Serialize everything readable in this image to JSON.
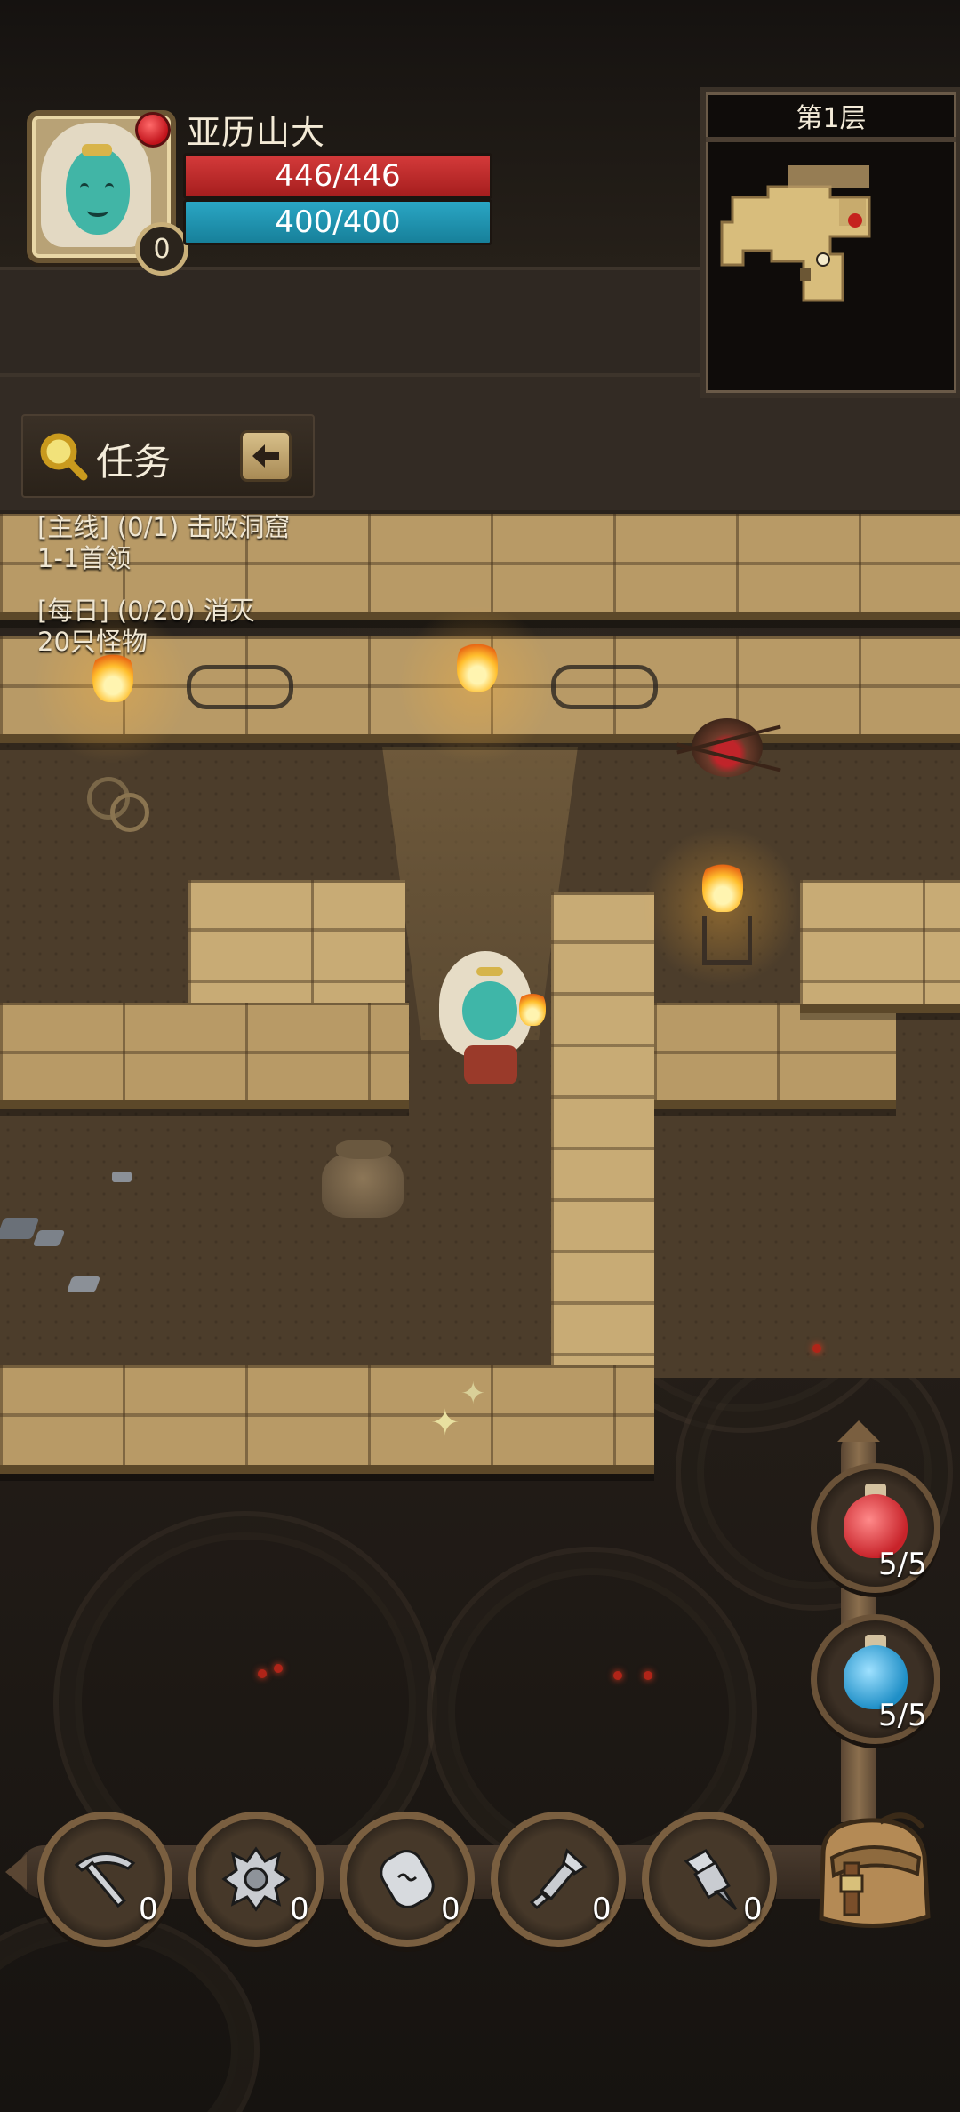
{
  "player": {
    "name": "亚历山大",
    "level": "0",
    "hp": "446/446",
    "mp": "400/400",
    "hp_fraction": 1.0,
    "mp_fraction": 1.0
  },
  "minimap": {
    "floor_label": "第1层"
  },
  "quest": {
    "title": "任务",
    "entries": [
      "[主线] (0/1) 击败洞窟\n1-1首领",
      "[每日] (0/20) 消灭\n20只怪物"
    ]
  },
  "potions": {
    "health_count": "5/5",
    "mana_count": "5/5"
  },
  "toolbar": {
    "tools": [
      {
        "name": "pickaxe-icon",
        "count": "0"
      },
      {
        "name": "spiked-shield-icon",
        "count": "0"
      },
      {
        "name": "scroll-bomb-icon",
        "count": "0"
      },
      {
        "name": "claw-tool-icon",
        "count": "0"
      },
      {
        "name": "drill-icon",
        "count": "0"
      }
    ]
  },
  "colors": {
    "hp_bar": "#c22c2c",
    "mp_bar": "#2196b3",
    "parchment": "#b89a66",
    "frame_gold": "#c9b07a"
  }
}
